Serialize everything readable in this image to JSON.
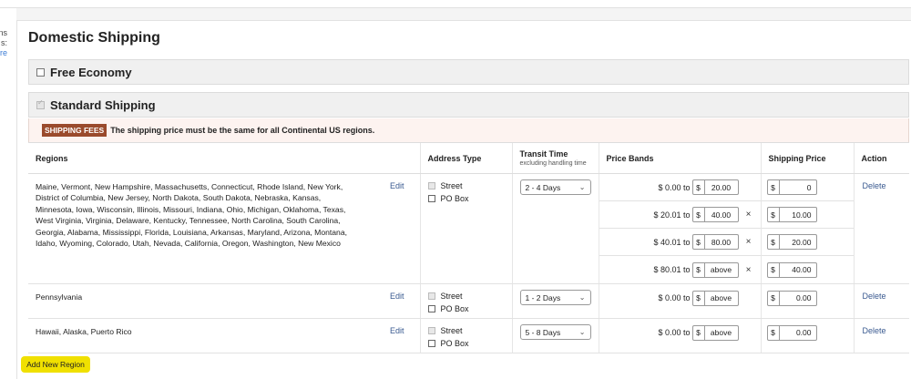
{
  "left_strip": {
    "line1": "ns",
    "line2": "s:",
    "line3": "re"
  },
  "panel": {
    "title": "Domestic Shipping"
  },
  "sections": {
    "free_economy": "Free Economy",
    "standard_shipping": "Standard Shipping"
  },
  "notice": {
    "badge": "SHIPPING FEES",
    "text": "The shipping price must be the same for all Continental US regions."
  },
  "table": {
    "headers": {
      "regions": "Regions",
      "address_type": "Address Type",
      "transit_time": "Transit Time",
      "transit_sub": "excluding handling time",
      "price_bands": "Price Bands",
      "shipping_price": "Shipping Price",
      "action": "Action"
    },
    "rows": [
      {
        "regions": "Maine, Vermont, New Hampshire, Massachusetts, Connecticut, Rhode Island, New York, District of Columbia, New Jersey, North Dakota, South Dakota, Nebraska, Kansas, Minnesota, Iowa, Wisconsin, Illinois, Missouri, Indiana, Ohio, Michigan, Oklahoma, Texas, West Virginia, Virginia, Delaware, Kentucky, Tennessee, North Carolina, South Carolina, Georgia, Alabama, Mississippi, Florida, Louisiana, Arkansas, Maryland, Arizona, Montana, Idaho, Wyoming, Colorado, Utah, Nevada, California, Oregon, Washington, New Mexico",
        "edit": "Edit",
        "street": "Street",
        "po_box": "PO Box",
        "transit": "2 - 4 Days",
        "bands": [
          {
            "from": "$ 0.00 to",
            "to": "20.00",
            "times": ""
          },
          {
            "from": "$ 20.01 to",
            "to": "40.00",
            "times": "×"
          },
          {
            "from": "$ 40.01 to",
            "to": "80.00",
            "times": "×"
          },
          {
            "from": "$ 80.01 to",
            "to": "above",
            "times": "×"
          }
        ],
        "prices": [
          "0",
          "10.00",
          "20.00",
          "40.00"
        ],
        "action": "Delete"
      },
      {
        "regions": "Pennsylvania",
        "edit": "Edit",
        "street": "Street",
        "po_box": "PO Box",
        "transit": "1 - 2 Days",
        "bands": [
          {
            "from": "$ 0.00 to",
            "to": "above",
            "times": ""
          }
        ],
        "prices": [
          "0.00"
        ],
        "action": "Delete"
      },
      {
        "regions": "Hawaii, Alaska, Puerto Rico",
        "edit": "Edit",
        "street": "Street",
        "po_box": "PO Box",
        "transit": "5 - 8 Days",
        "bands": [
          {
            "from": "$ 0.00 to",
            "to": "above",
            "times": ""
          }
        ],
        "prices": [
          "0.00"
        ],
        "action": "Delete"
      }
    ]
  },
  "currency_symbol": "$",
  "add_region_button": "Add New Region",
  "colors": {
    "badge": "#9a4a2c",
    "add_button": "#f0e000",
    "link": "#3a5a90"
  }
}
